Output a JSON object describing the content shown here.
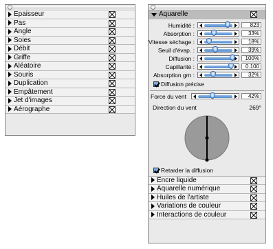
{
  "left_palette": {
    "items": [
      {
        "label": "Epaisseur"
      },
      {
        "label": "Pas"
      },
      {
        "label": "Angle"
      },
      {
        "label": "Soies"
      },
      {
        "label": "Débit"
      },
      {
        "label": "Griffe"
      },
      {
        "label": "Aléatoire"
      },
      {
        "label": "Souris"
      },
      {
        "label": "Duplication"
      },
      {
        "label": "Empâtement"
      },
      {
        "label": "Jet d'images"
      },
      {
        "label": "Aérographe"
      }
    ]
  },
  "right_palette": {
    "header": {
      "label": "Aquarelle"
    },
    "controls": [
      {
        "label": "Humidité :",
        "value": "823",
        "level": 0.84
      },
      {
        "label": "Absorption :",
        "value": "33%",
        "level": 0.33
      },
      {
        "label": "Vitesse séchage :",
        "value": "18%",
        "level": 0.18
      },
      {
        "label": "Seuil d'évap. :",
        "value": "39%",
        "level": 0.39
      },
      {
        "label": "Diffusion :",
        "value": "100%",
        "level": 1.0
      },
      {
        "label": "Capillarité :",
        "value": "0.100",
        "level": 0.95
      },
      {
        "label": "Absorption grn :",
        "value": "32%",
        "level": 0.32
      }
    ],
    "diffusion_precise": {
      "label": "Diffusion précise",
      "checked": true
    },
    "wind_force": {
      "label": "Force du vent",
      "value": "42%",
      "level": 0.42
    },
    "wind_direction": {
      "label": "Direction du vent",
      "value": "269°",
      "angle": 269
    },
    "retard": {
      "label": "Retarder la diffusion",
      "checked": true
    },
    "sections": [
      {
        "label": "Encre liquide"
      },
      {
        "label": "Aquarelle numérique"
      },
      {
        "label": "Huiles de l'artiste"
      },
      {
        "label": "Variations de couleur"
      },
      {
        "label": "Interactions de couleur"
      }
    ]
  }
}
